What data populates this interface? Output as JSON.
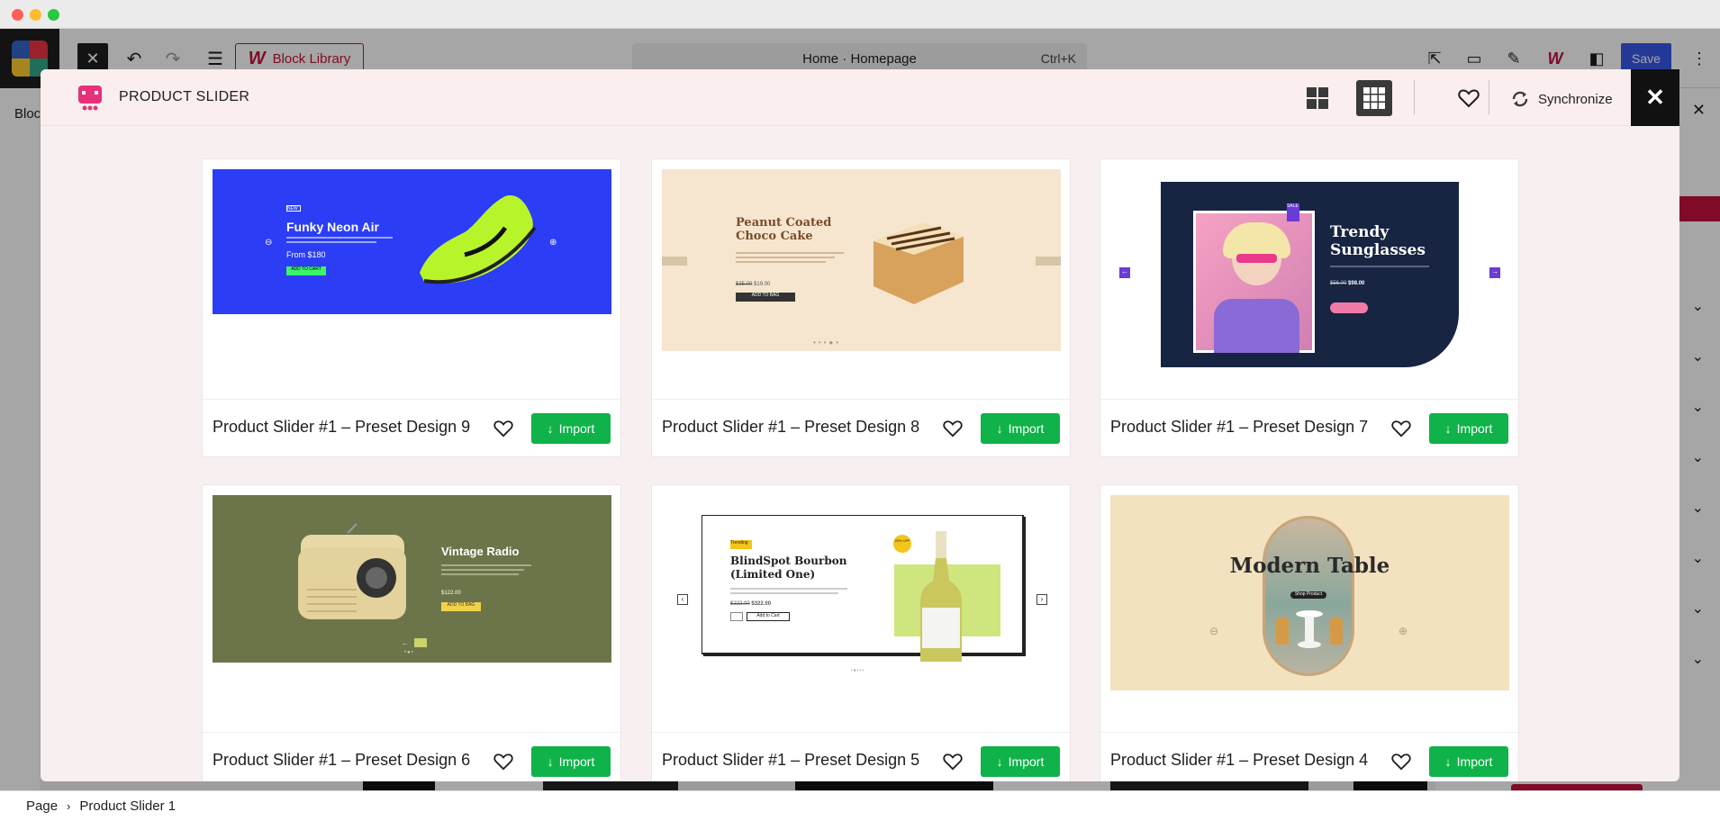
{
  "editor": {
    "block_library_label": "Block Library",
    "document_title": "Home · Homepage",
    "shortcut": "Ctrl+K",
    "save_label": "Save",
    "left_tab_label": "Bloc",
    "breadcrumb": [
      "Page",
      "Product Slider 1"
    ]
  },
  "modal": {
    "title": "PRODUCT SLIDER",
    "sync_label": "Synchronize",
    "import_label": "Import",
    "cards": [
      {
        "title": "Product Slider #1 – Preset Design 9",
        "preview": {
          "heading": "Funky Neon Air",
          "price": "From $180",
          "badge": "NEW",
          "cta": "ADD TO CART"
        }
      },
      {
        "title": "Product Slider #1 – Preset Design 8",
        "preview": {
          "heading": "Peanut Coated Choco Cake",
          "old_price": "$35.00",
          "price": "$19.00",
          "cta": "ADD TO BAG"
        }
      },
      {
        "title": "Product Slider #1 – Preset Design 7",
        "preview": {
          "heading": "Trendy Sunglasses",
          "old_price": "$56.00",
          "price": "$98.00",
          "badge": "SALE"
        }
      },
      {
        "title": "Product Slider #1 – Preset Design 6",
        "preview": {
          "heading": "Vintage Radio",
          "price": "$122.00",
          "cta": "ADD TO BAG"
        }
      },
      {
        "title": "Product Slider #1 – Preset Design 5",
        "preview": {
          "heading": "BlindSpot Bourbon (Limited One)",
          "old_price": "$222.00",
          "price": "$322.00",
          "badge": "Trending",
          "cta": "Add to Cart",
          "discount": "20% OFF"
        }
      },
      {
        "title": "Product Slider #1 – Preset Design 4",
        "preview": {
          "heading": "Modern Table",
          "cta": "Shop Product"
        }
      }
    ]
  },
  "colors": {
    "accent": "#c4113e",
    "import_green": "#10b24a",
    "save_blue": "#3858e9",
    "modal_bg": "#f8eff1"
  },
  "icons": [
    "grid-2x2-icon",
    "grid-3x3-icon",
    "heart-icon",
    "sync-icon",
    "close-icon",
    "arrow-down-icon"
  ]
}
